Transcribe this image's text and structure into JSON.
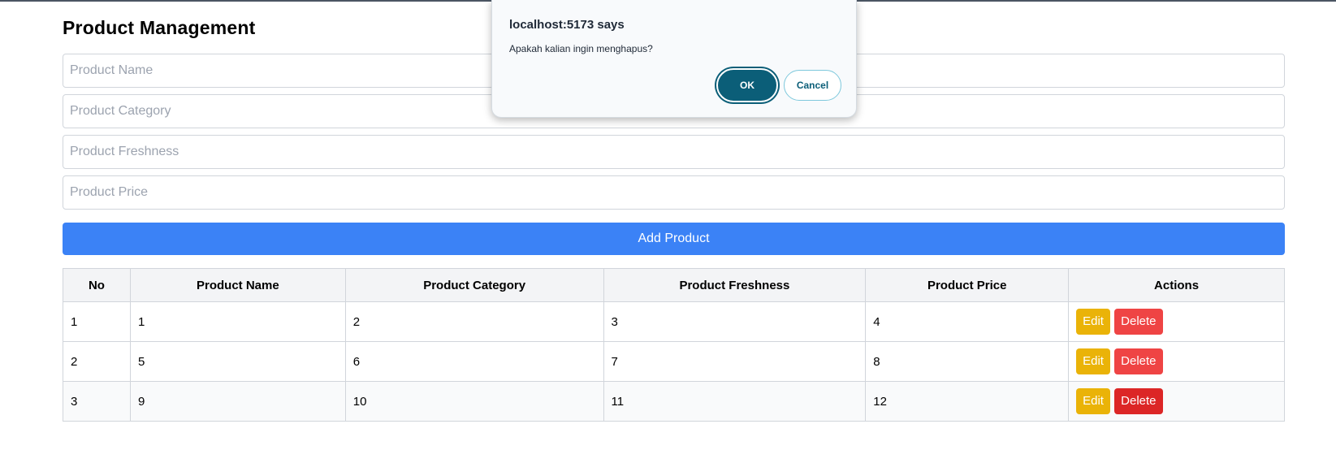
{
  "page": {
    "title": "Product Management"
  },
  "form": {
    "product_name": {
      "placeholder": "Product Name",
      "value": ""
    },
    "product_category": {
      "placeholder": "Product Category",
      "value": ""
    },
    "product_freshness": {
      "placeholder": "Product Freshness",
      "value": ""
    },
    "product_price": {
      "placeholder": "Product Price",
      "value": ""
    },
    "add_label": "Add Product"
  },
  "table": {
    "headers": [
      "No",
      "Product Name",
      "Product Category",
      "Product Freshness",
      "Product Price",
      "Actions"
    ],
    "rows": [
      {
        "no": "1",
        "name": "1",
        "category": "2",
        "freshness": "3",
        "price": "4"
      },
      {
        "no": "2",
        "name": "5",
        "category": "6",
        "freshness": "7",
        "price": "8"
      },
      {
        "no": "3",
        "name": "9",
        "category": "10",
        "freshness": "11",
        "price": "12"
      }
    ],
    "edit_label": "Edit",
    "delete_label": "Delete"
  },
  "dialog": {
    "title": "localhost:5173 says",
    "message": "Apakah kalian ingin menghapus?",
    "ok_label": "OK",
    "cancel_label": "Cancel"
  },
  "colors": {
    "primary": "#3b82f6",
    "edit": "#eab308",
    "delete": "#ef4444",
    "dialog_accent": "#0b5e78"
  }
}
